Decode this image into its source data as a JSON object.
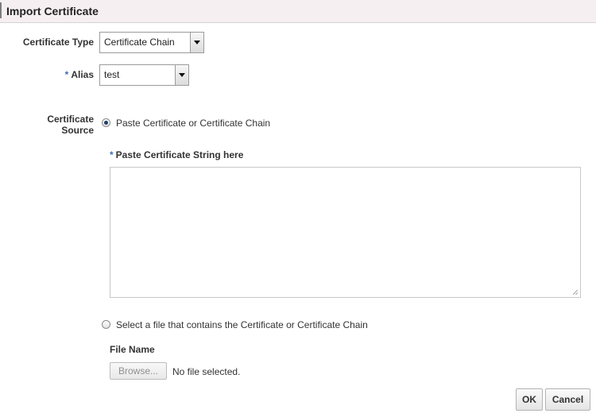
{
  "dialog": {
    "title": "Import Certificate"
  },
  "form": {
    "certificate_type": {
      "label": "Certificate Type",
      "value": "Certificate Chain"
    },
    "alias": {
      "required_mark": "*",
      "label": "Alias",
      "value": "test"
    },
    "certificate_source": {
      "label_line1": "Certificate",
      "label_line2": "Source",
      "option_paste": {
        "label": "Paste Certificate or Certificate Chain",
        "selected": true
      },
      "paste_field": {
        "required_mark": "*",
        "label": "Paste Certificate String here",
        "value": ""
      },
      "option_file": {
        "label": "Select a file that contains the Certificate or Certificate Chain",
        "selected": false
      },
      "file_name": {
        "label": "File Name",
        "browse_label": "Browse...",
        "status": "No file selected."
      }
    }
  },
  "buttons": {
    "ok": "OK",
    "cancel": "Cancel"
  },
  "colors": {
    "title_bar": "#f6eff1",
    "required": "#3b6fb6"
  },
  "icons": {
    "dropdown": "chevron-down-icon",
    "resize": "resize-grip-icon"
  }
}
